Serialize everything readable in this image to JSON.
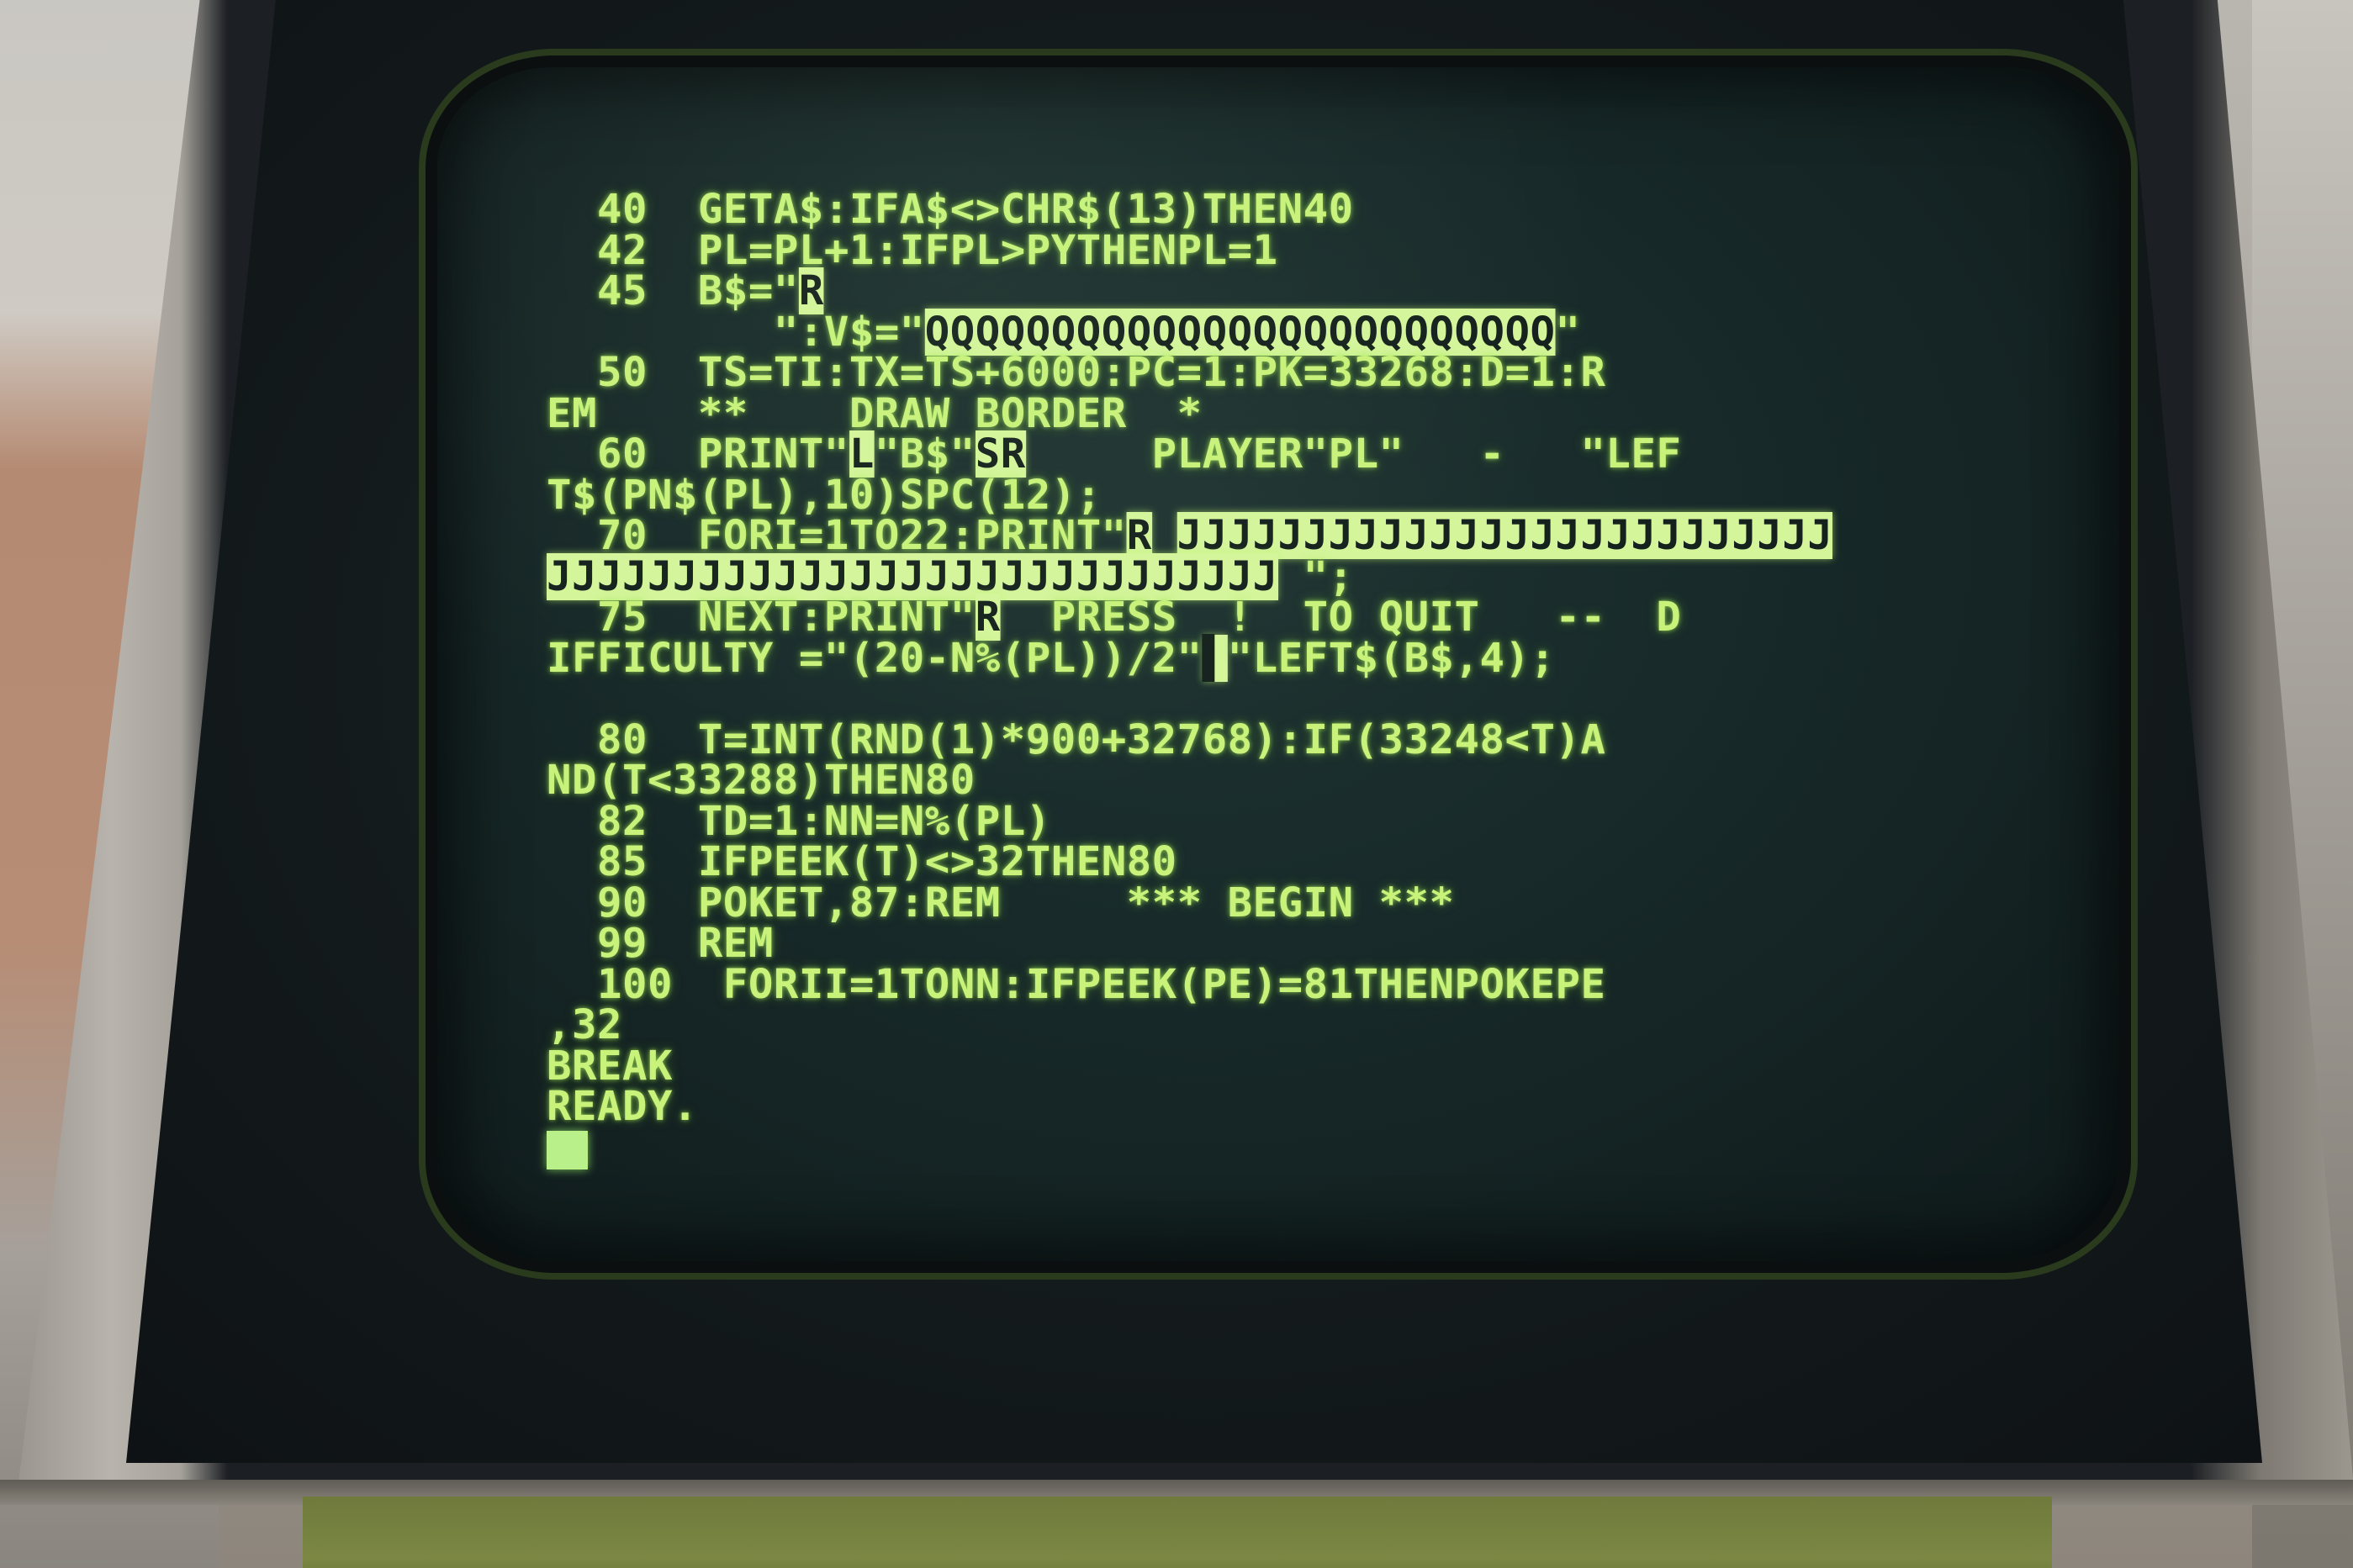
{
  "screen": {
    "lines": [
      {
        "segments": [
          {
            "text": "  40  GETA$:IFA$<>CHR$(13)THEN40"
          }
        ]
      },
      {
        "segments": [
          {
            "text": "  42  PL=PL+1:IFPL>PYTHENPL=1"
          }
        ]
      },
      {
        "segments": [
          {
            "text": "  45  B$=\""
          },
          {
            "text": "R",
            "reverse": true
          }
        ]
      },
      {
        "segments": [
          {
            "text": "         \":V$=\""
          },
          {
            "text": "QQQQQQQQQQQQQQQQQQQQQQQQQ",
            "reverse": true
          },
          {
            "text": "\""
          }
        ]
      },
      {
        "segments": [
          {
            "text": "  50  TS=TI:TX=TS+6000:PC=1:PK=33268:D=1:R"
          }
        ]
      },
      {
        "segments": [
          {
            "text": "EM    **    DRAW BORDER  *"
          }
        ]
      },
      {
        "segments": [
          {
            "text": "  60  PRINT\""
          },
          {
            "text": "L",
            "reverse": true
          },
          {
            "text": "\"B$\""
          },
          {
            "text": "SR",
            "reverse": true
          },
          {
            "text": "     PLAYER\"PL\"   -   \"LEF"
          }
        ]
      },
      {
        "segments": [
          {
            "text": "T$(PN$(PL),10)SPC(12);"
          }
        ]
      },
      {
        "segments": [
          {
            "text": "  70  FORI=1TO22:PRINT\""
          },
          {
            "text": "R",
            "reverse": true
          },
          {
            "text": " "
          },
          {
            "text": "JJJJJJJJJJJJJJJJJJJJJJJJJJ",
            "reverse": true
          }
        ]
      },
      {
        "segments": [
          {
            "text": "JJJJJJJJJJJJJJJJJJJJJJJJJJJJJ",
            "reverse": true
          },
          {
            "text": " \";"
          }
        ]
      },
      {
        "segments": [
          {
            "text": "  75  NEXT:PRINT\""
          },
          {
            "text": "R",
            "reverse": true
          },
          {
            "text": "  PRESS  !  TO QUIT   --  D"
          }
        ]
      },
      {
        "segments": [
          {
            "text": "IFFICULTY =\"(20-N%(PL))/2\""
          },
          {
            "text": "▌",
            "reverse": true
          },
          {
            "text": "\"LEFT$(B$,4);"
          }
        ]
      },
      {
        "segments": [
          {
            "text": ""
          }
        ]
      },
      {
        "segments": [
          {
            "text": "  80  T=INT(RND(1)*900+32768):IF(33248<T)A"
          }
        ]
      },
      {
        "segments": [
          {
            "text": "ND(T<33288)THEN80"
          }
        ]
      },
      {
        "segments": [
          {
            "text": "  82  TD=1:NN=N%(PL)"
          }
        ]
      },
      {
        "segments": [
          {
            "text": "  85  IFPEEK(T)<>32THEN80"
          }
        ]
      },
      {
        "segments": [
          {
            "text": "  90  POKET,87:REM     *** BEGIN ***"
          }
        ]
      },
      {
        "segments": [
          {
            "text": "  99  REM"
          }
        ]
      },
      {
        "segments": [
          {
            "text": "  100  FORII=1TONN:IFPEEK(PE)=81THENPOKEPE"
          }
        ]
      },
      {
        "segments": [
          {
            "text": ",32"
          }
        ]
      },
      {
        "segments": [
          {
            "text": "BREAK"
          }
        ]
      },
      {
        "segments": [
          {
            "text": "READY."
          }
        ]
      }
    ],
    "phosphor_color": "#c8f27a",
    "background_color": "#182a2a"
  }
}
